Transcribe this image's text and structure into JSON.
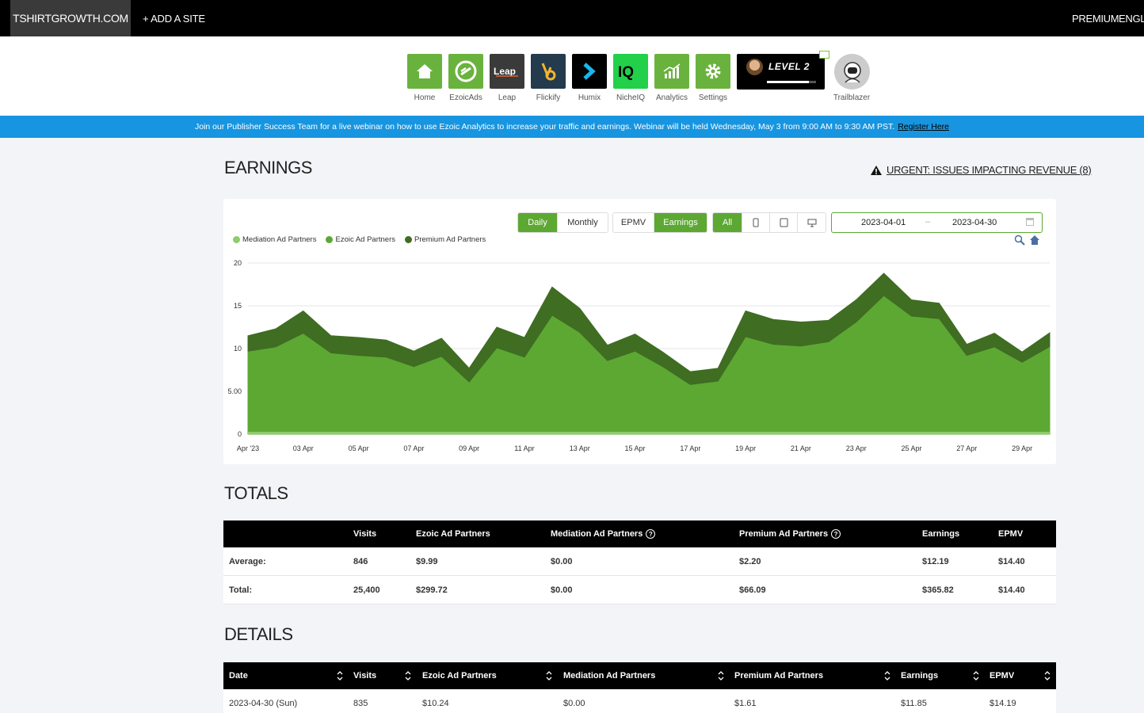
{
  "topbar": {
    "site": "TSHIRTGROWTH.COM",
    "add_site": "+ ADD A SITE",
    "premium": "PREMIUM",
    "language": "ENGLIS"
  },
  "apps": [
    {
      "label": "Home",
      "icon": "home-icon",
      "color": "#6ab23e"
    },
    {
      "label": "EzoicAds",
      "icon": "ezoicads-icon",
      "color": "#6ab23e"
    },
    {
      "label": "Leap",
      "icon": "leap-icon",
      "color": "#3a3a3a"
    },
    {
      "label": "Flickify",
      "icon": "flickify-icon",
      "color": "#243a4d"
    },
    {
      "label": "Humix",
      "icon": "humix-icon",
      "color": "#000000"
    },
    {
      "label": "NicheIQ",
      "icon": "nicheiq-icon",
      "color": "#22d04a"
    },
    {
      "label": "Analytics",
      "icon": "analytics-icon",
      "color": "#6ab23e"
    },
    {
      "label": "Settings",
      "icon": "settings-icon",
      "color": "#6ab23e"
    }
  ],
  "level": {
    "text": "LEVEL 2",
    "progress": 0.85
  },
  "profile": {
    "label": "Trailblazer"
  },
  "banner": {
    "text": "Join our Publisher Success Team for a live webinar on how to use Ezoic Analytics to increase your traffic and earnings. Webinar will be held Wednesday, May 3 from 9:00 AM to 9:30 AM PST.",
    "link": "Register Here"
  },
  "earnings": {
    "title": "EARNINGS",
    "urgent": "URGENT: ISSUES IMPACTING REVENUE (8)",
    "period_buttons": [
      "Daily",
      "Monthly"
    ],
    "metric_buttons": [
      "EPMV",
      "Earnings"
    ],
    "device_all": "All",
    "date_from": "2023-04-01",
    "date_sep": "–",
    "date_to": "2023-04-30"
  },
  "chart_data": {
    "type": "area",
    "stacked": true,
    "x": [
      "Apr '23",
      "02 Apr",
      "03 Apr",
      "04 Apr",
      "05 Apr",
      "06 Apr",
      "07 Apr",
      "08 Apr",
      "09 Apr",
      "10 Apr",
      "11 Apr",
      "12 Apr",
      "13 Apr",
      "14 Apr",
      "15 Apr",
      "16 Apr",
      "17 Apr",
      "18 Apr",
      "19 Apr",
      "20 Apr",
      "21 Apr",
      "22 Apr",
      "23 Apr",
      "24 Apr",
      "25 Apr",
      "26 Apr",
      "27 Apr",
      "28 Apr",
      "29 Apr",
      "30 Apr"
    ],
    "x_tick_labels": [
      "Apr '23",
      "03 Apr",
      "05 Apr",
      "07 Apr",
      "09 Apr",
      "11 Apr",
      "13 Apr",
      "15 Apr",
      "17 Apr",
      "19 Apr",
      "21 Apr",
      "23 Apr",
      "25 Apr",
      "27 Apr",
      "29 Apr"
    ],
    "y_ticks": [
      "0",
      "5.00",
      "10",
      "15",
      "20"
    ],
    "ylim": [
      0,
      20
    ],
    "series": [
      {
        "name": "Mediation Ad Partners",
        "color": "#8fcb6b",
        "values": [
          0,
          0,
          0,
          0,
          0,
          0,
          0,
          0,
          0,
          0,
          0,
          0,
          0,
          0,
          0,
          0,
          0,
          0,
          0,
          0,
          0,
          0,
          0,
          0,
          0,
          0,
          0,
          0,
          0,
          0
        ]
      },
      {
        "name": "Ezoic Ad Partners",
        "color": "#5ca833",
        "values": [
          9.7,
          10.2,
          11.8,
          9.5,
          9.2,
          9.0,
          7.9,
          9.1,
          6.1,
          10.1,
          9.0,
          13.9,
          11.9,
          8.6,
          9.7,
          7.9,
          5.8,
          6.2,
          11.4,
          10.5,
          10.3,
          10.8,
          13.1,
          16.2,
          13.8,
          13.5,
          9.2,
          10.2,
          8.4,
          10.24
        ]
      },
      {
        "name": "Premium Ad Partners",
        "color": "#3f6d22",
        "values": [
          1.8,
          2.1,
          2.6,
          2.0,
          2.1,
          2.0,
          1.8,
          2.1,
          1.6,
          2.4,
          2.3,
          3.3,
          2.8,
          1.8,
          2.0,
          1.7,
          1.5,
          1.5,
          3.0,
          2.9,
          2.8,
          2.5,
          2.6,
          2.6,
          1.9,
          1.8,
          1.3,
          1.6,
          1.2,
          1.61
        ]
      }
    ]
  },
  "totals": {
    "title": "TOTALS",
    "headers": [
      "Visits",
      "Ezoic Ad Partners",
      "Mediation Ad Partners",
      "Premium Ad Partners",
      "Earnings",
      "EPMV"
    ],
    "rows": [
      {
        "label": "Average:",
        "cells": [
          "846",
          "$9.99",
          "$0.00",
          "$2.20",
          "$12.19",
          "$14.40"
        ]
      },
      {
        "label": "Total:",
        "cells": [
          "25,400",
          "$299.72",
          "$0.00",
          "$66.09",
          "$365.82",
          "$14.40"
        ]
      }
    ]
  },
  "details": {
    "title": "DETAILS",
    "headers": [
      "Date",
      "Visits",
      "Ezoic Ad Partners",
      "Mediation Ad Partners",
      "Premium Ad Partners",
      "Earnings",
      "EPMV"
    ],
    "rows": [
      [
        "2023-04-30 (Sun)",
        "835",
        "$10.24",
        "$0.00",
        "$1.61",
        "$11.85",
        "$14.19"
      ]
    ]
  }
}
